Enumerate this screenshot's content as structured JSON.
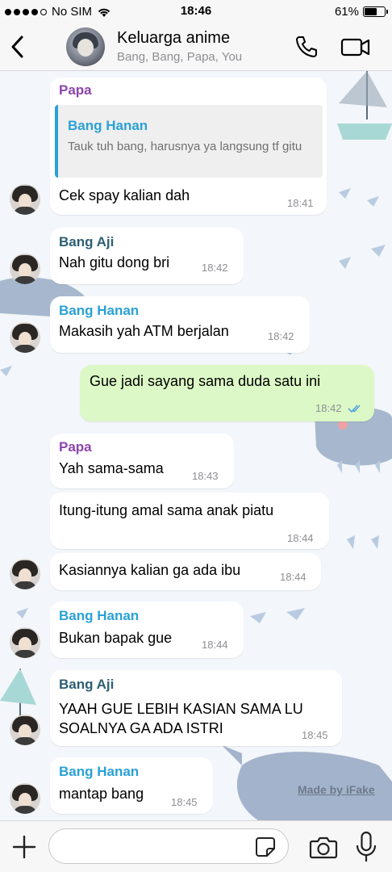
{
  "status_bar": {
    "carrier": "No SIM",
    "time": "18:46",
    "battery": "61%",
    "battery_level": 0.61
  },
  "header": {
    "title": "Keluarga anime",
    "subtitle": "Bang, Bang, Papa, You"
  },
  "colors": {
    "papa": "#8e44ad",
    "bang_hanan": "#2aa1d6",
    "bang_aji": "#2d5f73",
    "outgoing_bubble": "#dcf8c6",
    "read_ticks": "#4fa3e0"
  },
  "messages": [
    {
      "sender": "Papa",
      "reply": {
        "name": "Bang Hanan",
        "text": "Tauk tuh bang, harusnya ya langsung tf gitu"
      },
      "text": "Cek spay kalian dah",
      "time": "18:41"
    },
    {
      "sender": "Bang Aji",
      "text": "Nah gitu dong bri",
      "time": "18:42"
    },
    {
      "sender": "Bang Hanan",
      "text": "Makasih yah ATM berjalan",
      "time": "18:42"
    },
    {
      "outgoing": true,
      "text": "Gue jadi sayang sama duda satu ini",
      "time": "18:42",
      "status": "read"
    },
    {
      "sender": "Papa",
      "text": "Yah sama-sama",
      "time": "18:43"
    },
    {
      "text": "Itung-itung amal sama anak piatu",
      "time": "18:44"
    },
    {
      "text": "Kasiannya kalian ga ada ibu",
      "time": "18:44"
    },
    {
      "sender": "Bang Hanan",
      "text": "Bukan bapak gue",
      "time": "18:44"
    },
    {
      "sender": "Bang Aji",
      "lines": [
        "YAAH GUE LEBIH KASIAN SAMA LU",
        "SOALNYA GA ADA ISTRI"
      ],
      "time": "18:45"
    },
    {
      "sender": "Bang Hanan",
      "text": "mantap bang",
      "time": "18:45"
    }
  ],
  "watermark": "Made by iFake",
  "composer": {
    "placeholder": ""
  }
}
